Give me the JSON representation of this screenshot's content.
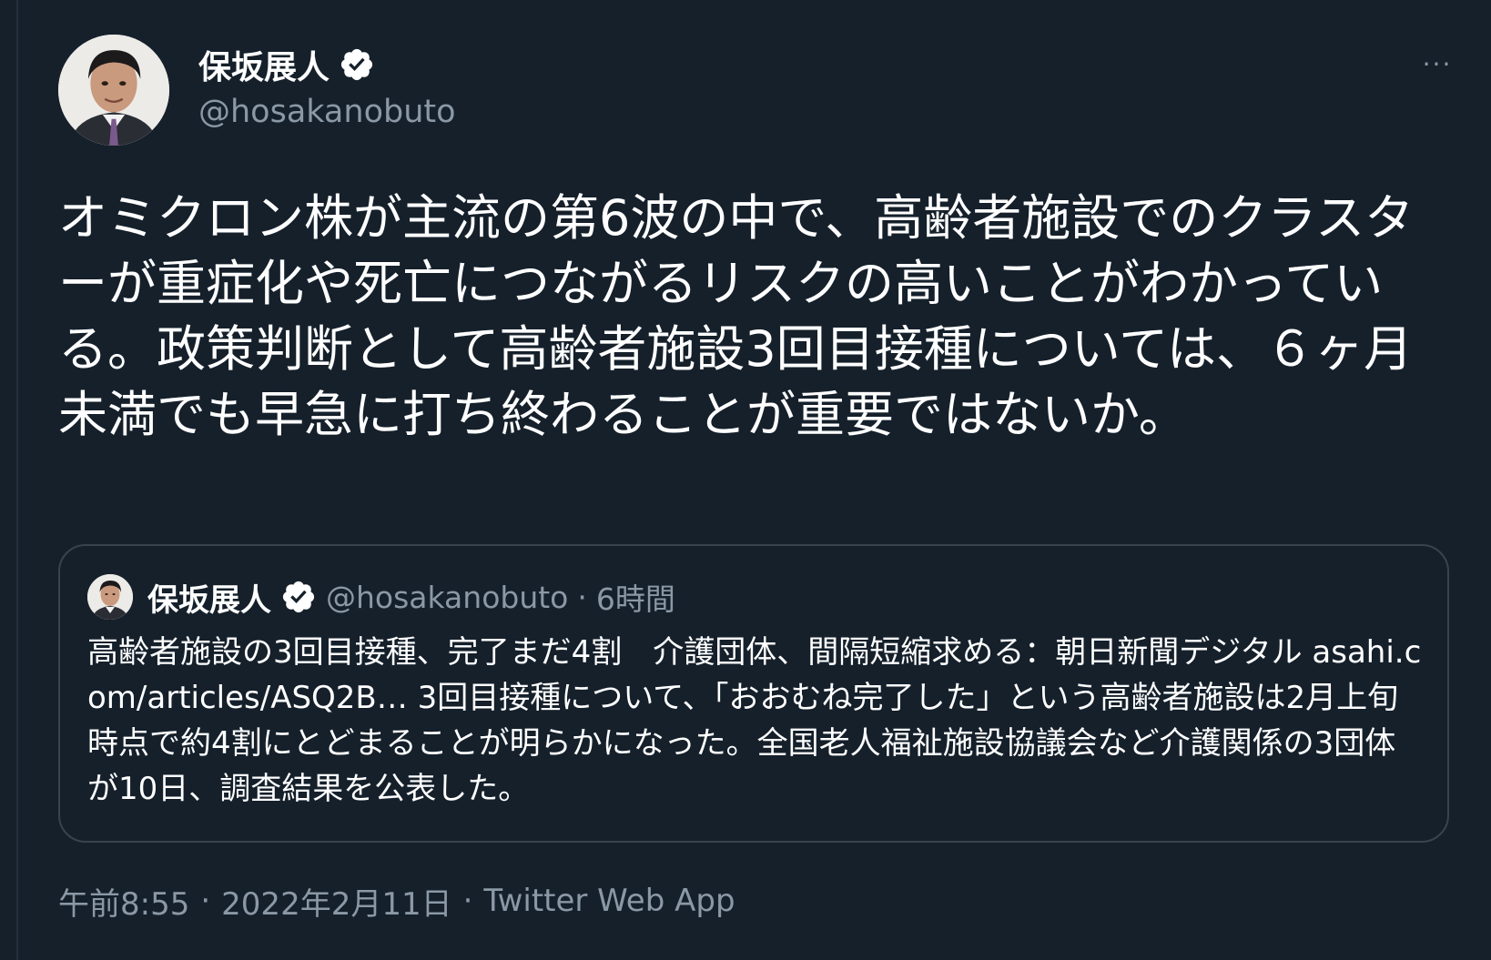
{
  "author": {
    "display_name": "保坂展人",
    "handle": "@hosakanobuto",
    "verified": true,
    "avatar_icon": "person-portrait-icon"
  },
  "more_icon": "more-horizontal-icon",
  "more_label": "···",
  "tweet": {
    "text": "オミクロン株が主流の第6波の中で、高齢者施設でのクラスターが重症化や死亡につながるリスクの高いことがわかっている。政策判断として高齢者施設3回目接種については、６ヶ月未満でも早急に打ち終わることが重要ではないか。"
  },
  "quote": {
    "display_name": "保坂展人",
    "handle": "@hosakanobuto",
    "separator": "·",
    "time": "6時間",
    "text_before_link": "高齢者施設の3回目接種、完了まだ4割　介護団体、間隔短縮求める：朝日新聞デジタル ",
    "link_text": "asahi.com/articles/ASQ2B…",
    "text_after_link": " 3回目接種について、「おおむね完了した」という高齢者施設は2月上旬時点で約4割にとどまることが明らかになった。全国老人福祉施設協議会など介護関係の3団体が10日、調査結果を公表した。"
  },
  "footer": {
    "time": "午前8:55",
    "sep1": "·",
    "date": "2022年2月11日",
    "sep2": "·",
    "source": "Twitter Web App"
  },
  "colors": {
    "background": "#15202b",
    "text": "#ffffff",
    "secondary": "#8b98a5",
    "border": "#38444d",
    "verified_badge": "#ffffff"
  }
}
